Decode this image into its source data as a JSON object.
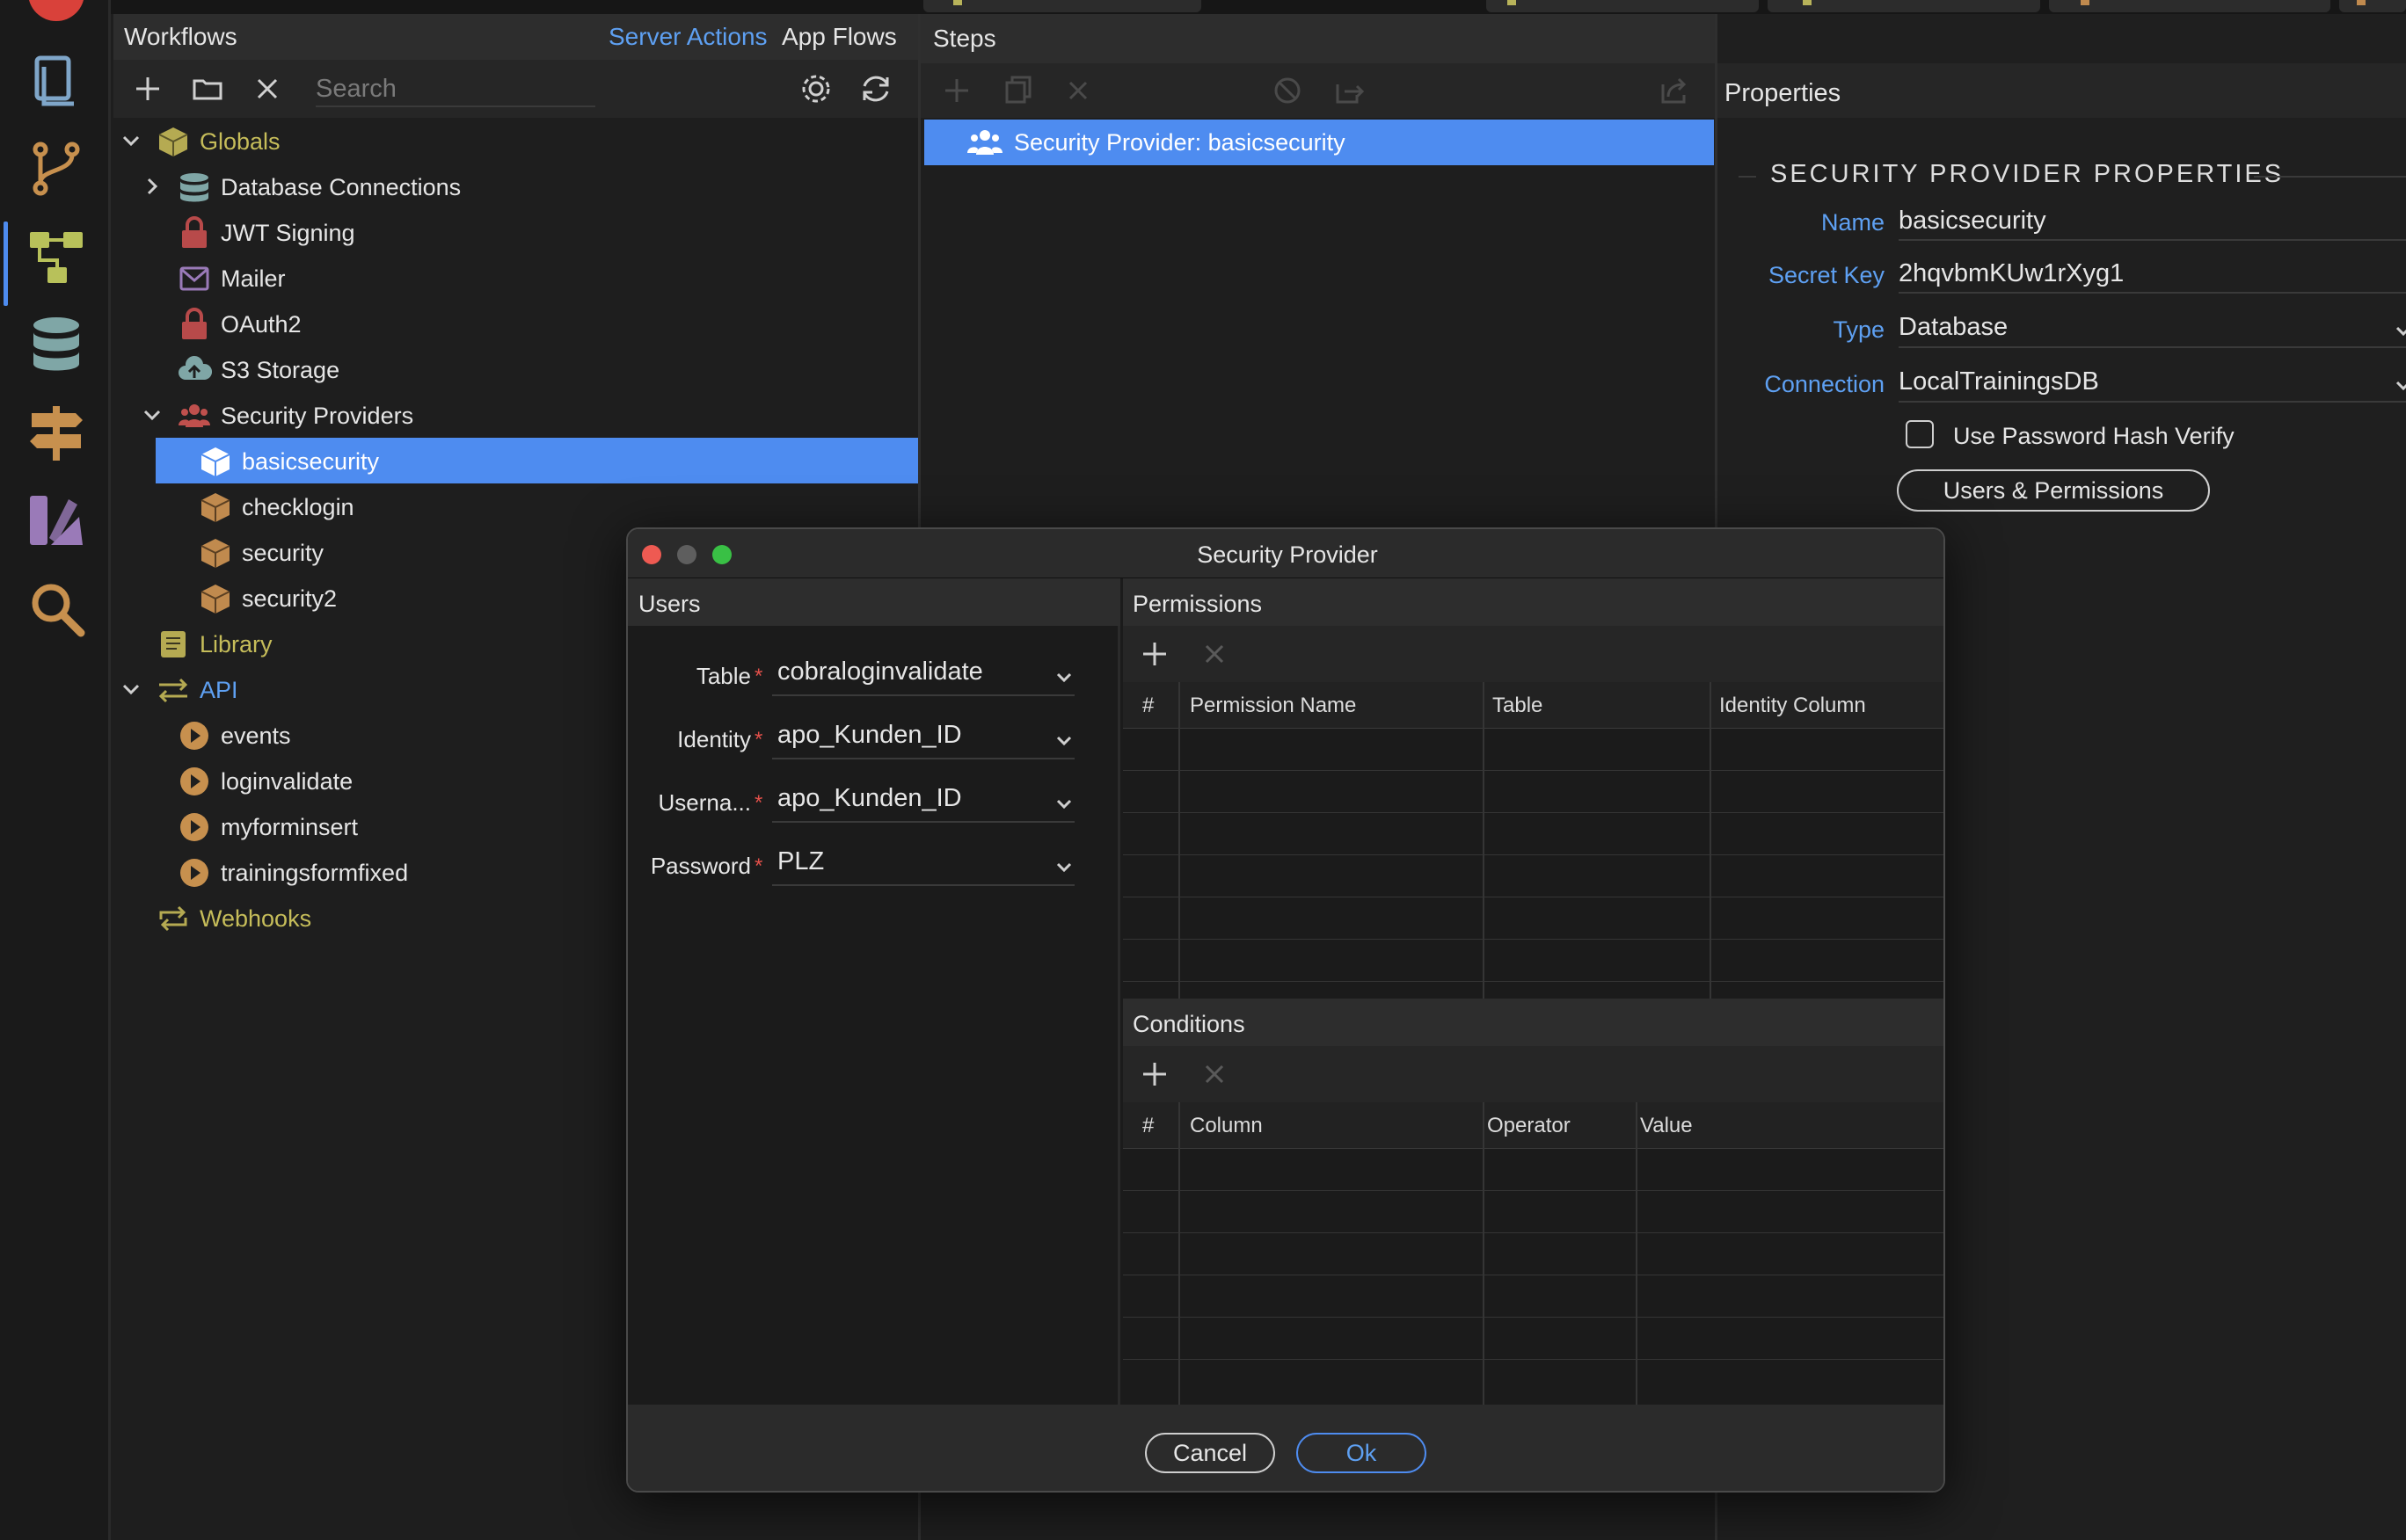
{
  "workflows": {
    "title": "Workflows",
    "server_actions": "Server Actions",
    "app_flows": "App Flows",
    "search_placeholder": "Search",
    "tree": [
      {
        "label": "Globals"
      },
      {
        "label": "Database Connections"
      },
      {
        "label": "JWT Signing"
      },
      {
        "label": "Mailer"
      },
      {
        "label": "OAuth2"
      },
      {
        "label": "S3 Storage"
      },
      {
        "label": "Security Providers"
      },
      {
        "label": "basicsecurity"
      },
      {
        "label": "checklogin"
      },
      {
        "label": "security"
      },
      {
        "label": "security2"
      },
      {
        "label": "Library"
      },
      {
        "label": "API"
      },
      {
        "label": "events"
      },
      {
        "label": "loginvalidate"
      },
      {
        "label": "myforminsert"
      },
      {
        "label": "trainingsformfixed"
      },
      {
        "label": "Webhooks"
      }
    ]
  },
  "steps": {
    "title": "Steps",
    "selected_label": "Security Provider: basicsecurity"
  },
  "properties": {
    "title": "Properties",
    "section": "SECURITY PROVIDER PROPERTIES",
    "name_label": "Name",
    "name_value": "basicsecurity",
    "secret_label": "Secret Key",
    "secret_value": "2hqvbmKUw1rXyg1",
    "type_label": "Type",
    "type_value": "Database",
    "connection_label": "Connection",
    "connection_value": "LocalTrainingsDB",
    "hash_label": "Use Password Hash Verify",
    "users_button": "Users & Permissions"
  },
  "dialog": {
    "title": "Security Provider",
    "users": {
      "title": "Users",
      "fields": [
        {
          "label": "Table",
          "value": "cobraloginvalidate"
        },
        {
          "label": "Identity",
          "value": "apo_Kunden_ID"
        },
        {
          "label": "Userna...",
          "value": "apo_Kunden_ID"
        },
        {
          "label": "Password",
          "value": "PLZ"
        }
      ],
      "required_mark": "*"
    },
    "permissions": {
      "title": "Permissions",
      "columns": [
        "#",
        "Permission Name",
        "Table",
        "Identity Column"
      ]
    },
    "conditions": {
      "title": "Conditions",
      "columns": [
        "#",
        "Column",
        "Operator",
        "Value"
      ]
    },
    "cancel": "Cancel",
    "ok": "Ok"
  },
  "colors": {
    "accent": "#4e8cf0",
    "link": "#5ea0f2",
    "folder": "#c6bd5a",
    "provider": "#c08a4e",
    "required": "#e3504a"
  }
}
